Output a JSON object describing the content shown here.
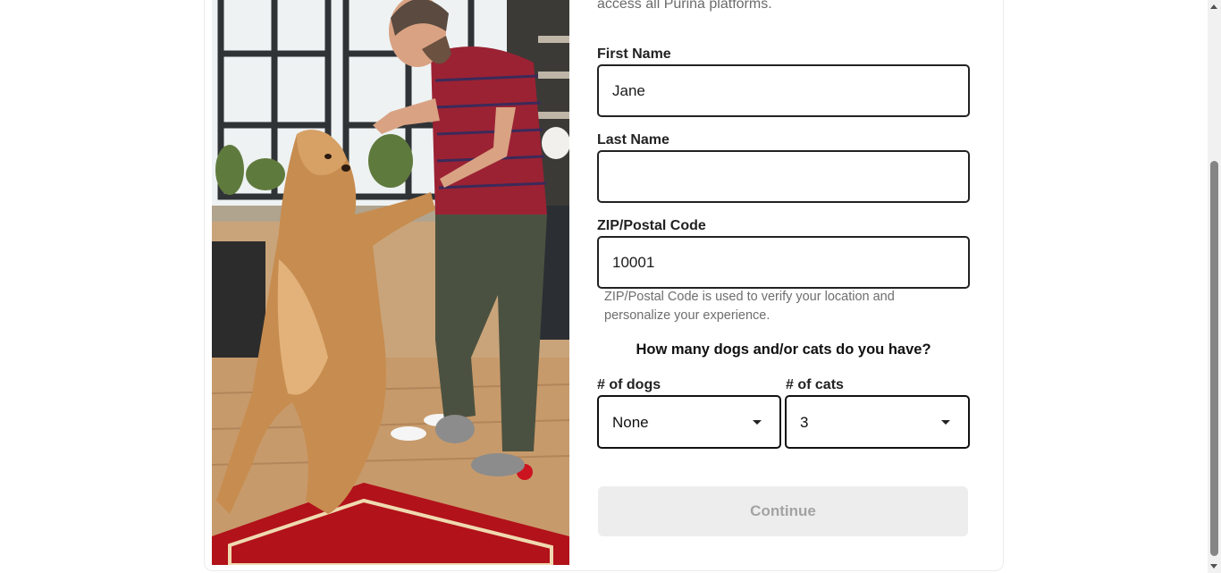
{
  "intro_text": "access all Purina platforms.",
  "photo": {
    "alt": "man playing with golden retriever dog in kitchen"
  },
  "form": {
    "first_name": {
      "label": "First Name",
      "value": "Jane",
      "placeholder": ""
    },
    "last_name": {
      "label": "Last Name",
      "value": "",
      "placeholder": ""
    },
    "zip": {
      "label": "ZIP/Postal Code",
      "value": "10001",
      "placeholder": "",
      "hint": "ZIP/Postal Code is used to verify your location and personalize your experience."
    },
    "pets_question": "How many dogs and/or cats do you have?",
    "dogs": {
      "label": "# of dogs",
      "selected": "None"
    },
    "cats": {
      "label": "# of cats",
      "selected": "3"
    },
    "continue_label": "Continue"
  },
  "colors": {
    "border": "#222222",
    "continue_bg": "#ededed",
    "continue_text": "#a3a3a3",
    "hint_text": "#6e6e6e"
  },
  "icons": {
    "dropdown": "chevron-down-icon",
    "scroll_up": "scroll-up-arrow-icon",
    "scroll_down": "scroll-down-arrow-icon"
  }
}
